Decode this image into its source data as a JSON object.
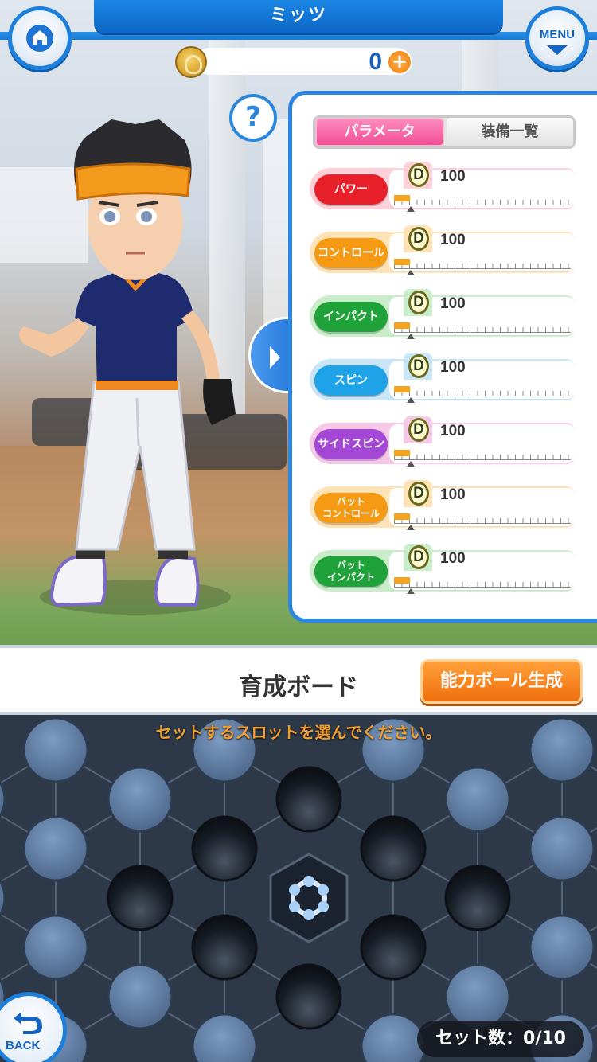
{
  "header": {
    "title": "ミッツ"
  },
  "currency": {
    "value": "0",
    "plus_label": "+"
  },
  "buttons": {
    "menu_label": "MENU",
    "help_label": "?",
    "back_label": "BACK"
  },
  "panel": {
    "tabs": [
      {
        "label": "パラメータ",
        "active": true
      },
      {
        "label": "装備一覧",
        "active": false
      }
    ],
    "params": [
      {
        "label": "パワー",
        "grade": "D",
        "value": "100",
        "color": "#e8202a",
        "frame": "#ffd0d8"
      },
      {
        "label": "コントロール",
        "grade": "D",
        "value": "100",
        "color": "#f59a12",
        "frame": "#ffe2b5"
      },
      {
        "label": "インパクト",
        "grade": "D",
        "value": "100",
        "color": "#1fa23a",
        "frame": "#c9ecc9"
      },
      {
        "label": "スピン",
        "grade": "D",
        "value": "100",
        "color": "#1ea3e8",
        "frame": "#c8e6f7"
      },
      {
        "label": "サイドスピン",
        "grade": "D",
        "value": "100",
        "color": "#a447d6",
        "frame": "#f4c8e6"
      },
      {
        "label_line1": "バット",
        "label_line2": "コントロール",
        "grade": "D",
        "value": "100",
        "color": "#f59a12",
        "frame": "#ffe2b5"
      },
      {
        "label_line1": "バット",
        "label_line2": "インパクト",
        "grade": "D",
        "value": "100",
        "color": "#1fa23a",
        "frame": "#c9ecc9"
      }
    ]
  },
  "board": {
    "title": "育成ボード",
    "generate_button": "能力ボール生成",
    "instruction": "セットするスロットを選んでください。",
    "counter": "セット数：0/10"
  }
}
